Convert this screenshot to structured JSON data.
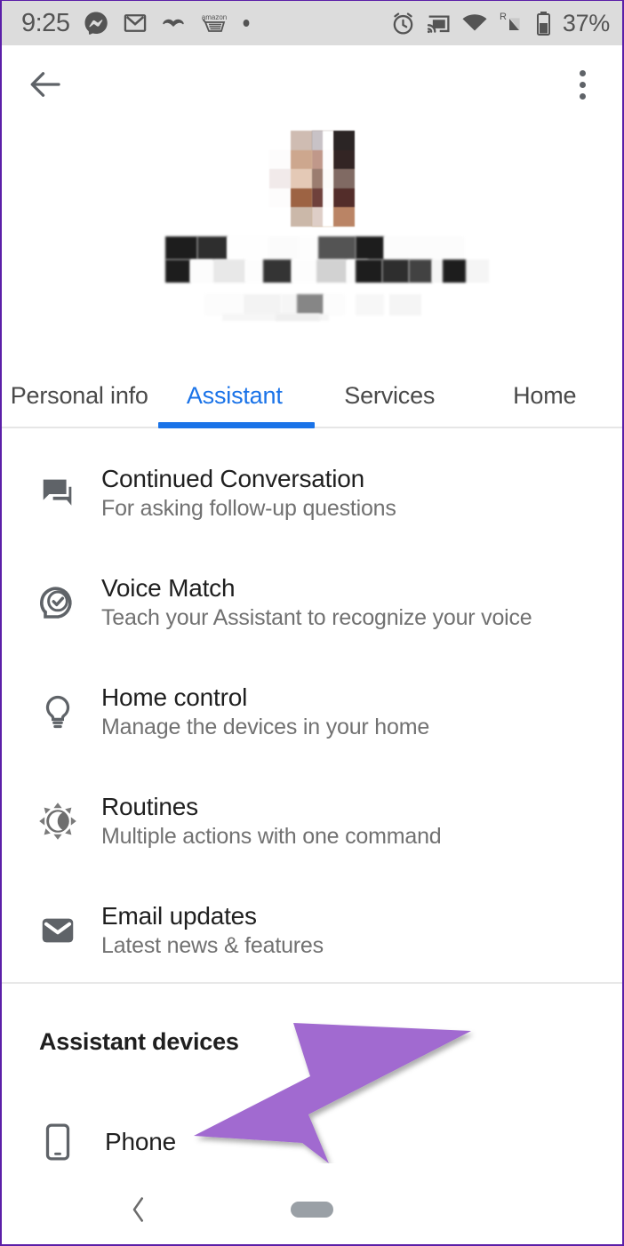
{
  "status_bar": {
    "time": "9:25",
    "battery_percent": "37%",
    "left_icons": [
      "messenger-icon",
      "gmail-icon",
      "mustache-icon",
      "amazon-cart-icon",
      "dot-icon"
    ],
    "right_icons": [
      "alarm-icon",
      "cast-icon",
      "wifi-icon",
      "signal-roaming-icon",
      "battery-icon"
    ],
    "roaming_label": "R",
    "background_color": "#dcdcdc",
    "text_color": "#545454"
  },
  "app_bar": {
    "back_icon": "arrow-back-icon",
    "overflow_icon": "more-vert-icon"
  },
  "profile": {
    "avatar_alt": "redacted-profile-photo",
    "name_alt": "redacted-user-name",
    "email_alt": "redacted-user-email"
  },
  "tabs": {
    "items": [
      {
        "label": "Personal info",
        "active": false
      },
      {
        "label": "Assistant",
        "active": true
      },
      {
        "label": "Services",
        "active": false
      },
      {
        "label": "Home",
        "active": false
      }
    ],
    "active_color": "#1a73e8",
    "inactive_color": "#4a4a4a"
  },
  "settings": {
    "items": [
      {
        "icon": "chat-bubbles-icon",
        "title": "Continued Conversation",
        "subtitle": "For asking follow-up questions"
      },
      {
        "icon": "voice-match-check-icon",
        "title": "Voice Match",
        "subtitle": "Teach your Assistant to recognize your voice"
      },
      {
        "icon": "lightbulb-icon",
        "title": "Home control",
        "subtitle": "Manage the devices in your home"
      },
      {
        "icon": "sun-moon-routines-icon",
        "title": "Routines",
        "subtitle": "Multiple actions with one command"
      },
      {
        "icon": "envelope-icon",
        "title": "Email updates",
        "subtitle": "Latest news & features"
      }
    ]
  },
  "devices_section": {
    "heading": "Assistant devices",
    "items": [
      {
        "icon": "smartphone-icon",
        "label": "Phone"
      }
    ]
  },
  "annotation": {
    "shape": "arrow-pointing-left-down",
    "color": "#a16bd0",
    "points_to": "Phone"
  },
  "nav_bar": {
    "back_icon": "chevron-left-icon",
    "home_pill_icon": "home-pill-icon"
  }
}
